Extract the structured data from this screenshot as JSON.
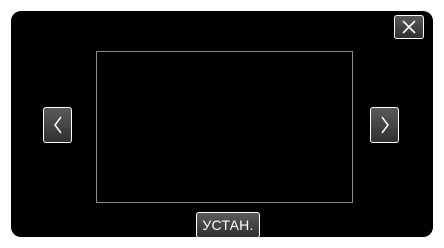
{
  "icons": {
    "close": "close-icon",
    "previous": "chevron-left-icon",
    "next": "chevron-right-icon"
  },
  "buttons": {
    "set_label": "УСТАН."
  },
  "colors": {
    "screen_background": "#000000",
    "button_border": "#ffffff",
    "frame_border": "#8a8a8a",
    "text": "#ffffff"
  }
}
